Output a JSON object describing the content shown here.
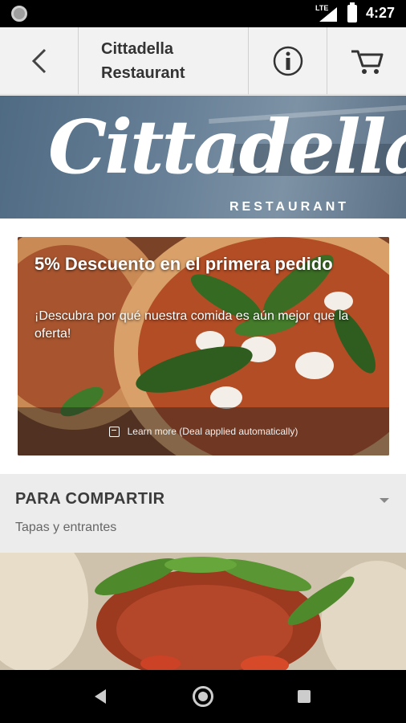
{
  "status_bar": {
    "network": "LTE",
    "time": "4:27"
  },
  "toolbar": {
    "title": "Cittadella Restaurant",
    "back_icon": "back-arrow-icon",
    "info_icon": "info-icon",
    "cart_icon": "cart-icon"
  },
  "banner": {
    "logo_text": "Cittadella",
    "logo_subtext": "RESTAURANT"
  },
  "promo": {
    "title": "5% Descuento en el primera pedido",
    "description": "¡Descubra por qué nuestra comida es aún mejor que la oferta!",
    "footer_text": "Learn more (Deal applied automatically)"
  },
  "category": {
    "title": "PARA COMPARTIR",
    "subtitle": "Tapas y entrantes"
  },
  "colors": {
    "toolbar_bg": "#f2f2f2",
    "banner_bg": "#5f778d",
    "category_bg": "#ececec"
  }
}
